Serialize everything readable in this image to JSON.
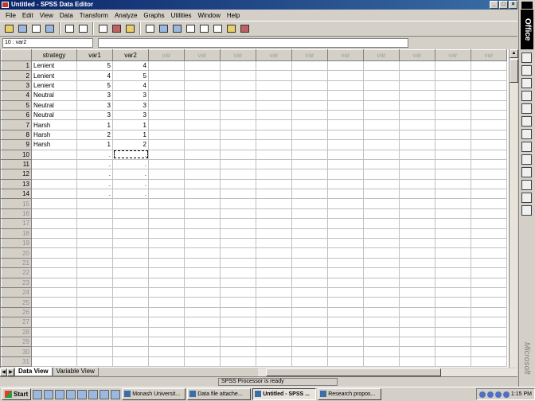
{
  "window": {
    "title": "Untitled - SPSS Data Editor",
    "min_label": "_",
    "max_label": "□",
    "close_label": "×"
  },
  "menu": [
    "File",
    "Edit",
    "View",
    "Data",
    "Transform",
    "Analyze",
    "Graphs",
    "Utilities",
    "Window",
    "Help"
  ],
  "cell_editor": {
    "reference": "10 : var2",
    "value": ""
  },
  "grid": {
    "columns": [
      "strategy",
      "var1",
      "var2",
      "var",
      "var",
      "var",
      "var",
      "var",
      "var",
      "var",
      "var",
      "var",
      "var"
    ],
    "rows": [
      [
        "Lenient",
        "5",
        "4"
      ],
      [
        "Lenient",
        "4",
        "5"
      ],
      [
        "Lenient",
        "5",
        "4"
      ],
      [
        "Neutral",
        "3",
        "3"
      ],
      [
        "Neutral",
        "3",
        "3"
      ],
      [
        "Neutral",
        "3",
        "3"
      ],
      [
        "Harsh",
        "1",
        "1"
      ],
      [
        "Harsh",
        "2",
        "1"
      ],
      [
        "Harsh",
        "1",
        "2"
      ],
      [
        "",
        ".",
        "."
      ],
      [
        "",
        ".",
        "."
      ],
      [
        "",
        ".",
        "."
      ],
      [
        "",
        ".",
        "."
      ],
      [
        "",
        ".",
        "."
      ]
    ],
    "row_count": 31,
    "selected_row": 10,
    "selected_col": 3
  },
  "tabs": {
    "data_view": "Data View",
    "variable_view": "Variable View"
  },
  "status": "SPSS Processor  is ready",
  "taskbar": {
    "start": "Start",
    "tasks": [
      "Monash Universit...",
      "Data file attache...",
      "Untitled - SPSS ...",
      "Research propos..."
    ],
    "active_task": 2,
    "clock": "1:15 PM"
  },
  "office_bar": {
    "label": "Office",
    "brand": "Microsoft"
  }
}
